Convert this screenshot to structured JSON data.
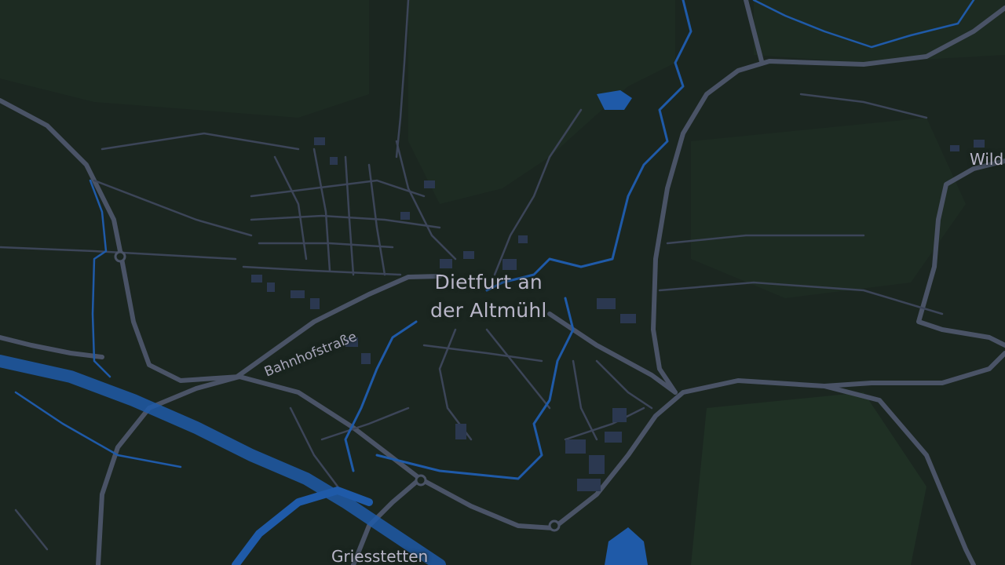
{
  "map": {
    "theme": "dark",
    "colors": {
      "land": "#1b2620",
      "forest": "#1d2b22",
      "road": "#4a5366",
      "minor_road": "#3c4558",
      "water": "#1f5aa8",
      "building": "#2b3850",
      "label": "#b9b6c9"
    },
    "labels": {
      "city_line1": "Dietfurt an",
      "city_line2": "der Altmühl",
      "street": "Bahnhofstraße",
      "village_south": "Griesstetten",
      "village_east": "Wild"
    }
  }
}
